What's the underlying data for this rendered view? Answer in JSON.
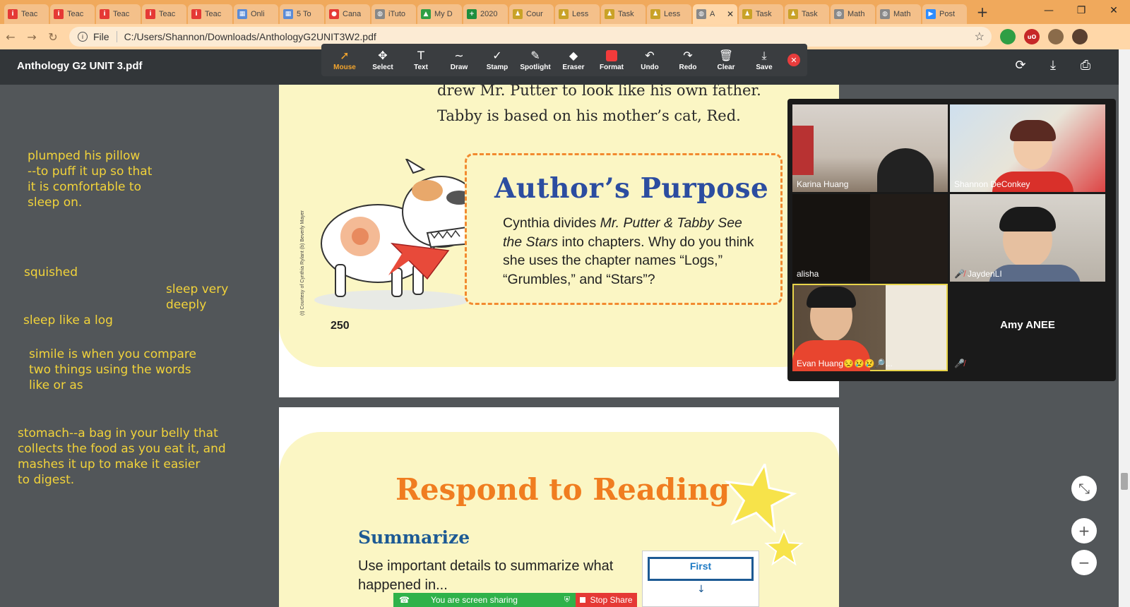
{
  "browser": {
    "tabs": [
      {
        "label": "Teac",
        "icon": "i-ready-icon",
        "color": "#e53935",
        "glyph": "i"
      },
      {
        "label": "Teac",
        "icon": "i-ready-icon",
        "color": "#e53935",
        "glyph": "i"
      },
      {
        "label": "Teac",
        "icon": "i-ready-icon",
        "color": "#e53935",
        "glyph": "i"
      },
      {
        "label": "Teac",
        "icon": "i-ready-icon",
        "color": "#e53935",
        "glyph": "i"
      },
      {
        "label": "Teac",
        "icon": "i-ready-icon",
        "color": "#e53935",
        "glyph": "i"
      },
      {
        "label": "Onli",
        "icon": "doc-icon",
        "color": "#5b8bd6",
        "glyph": "▦"
      },
      {
        "label": "5 To",
        "icon": "doc-icon",
        "color": "#5b8bd6",
        "glyph": "▦"
      },
      {
        "label": "Cana",
        "icon": "canvas-icon",
        "color": "#e53935",
        "glyph": "●"
      },
      {
        "label": "iTuto",
        "icon": "globe-icon",
        "color": "#888888",
        "glyph": "◍"
      },
      {
        "label": "My D",
        "icon": "drive-icon",
        "color": "#2f9e44",
        "glyph": "▲"
      },
      {
        "label": "2020",
        "icon": "sheets-icon",
        "color": "#1e8e3e",
        "glyph": "+"
      },
      {
        "label": "Cour",
        "icon": "person-icon",
        "color": "#c9a227",
        "glyph": "♟"
      },
      {
        "label": "Less",
        "icon": "person-icon",
        "color": "#c9a227",
        "glyph": "♟"
      },
      {
        "label": "Task",
        "icon": "person-icon",
        "color": "#c9a227",
        "glyph": "♟"
      },
      {
        "label": "Less",
        "icon": "person-icon",
        "color": "#c9a227",
        "glyph": "♟"
      },
      {
        "label": "A",
        "icon": "globe-icon",
        "color": "#888888",
        "glyph": "◍",
        "active": true
      },
      {
        "label": "Task",
        "icon": "person-icon",
        "color": "#c9a227",
        "glyph": "♟"
      },
      {
        "label": "Task",
        "icon": "person-icon",
        "color": "#c9a227",
        "glyph": "♟"
      },
      {
        "label": "Math",
        "icon": "globe-icon",
        "color": "#888888",
        "glyph": "◍"
      },
      {
        "label": "Math",
        "icon": "globe-icon",
        "color": "#888888",
        "glyph": "◍"
      },
      {
        "label": "Post",
        "icon": "zoom-icon",
        "color": "#2d8cff",
        "glyph": "▶"
      }
    ],
    "omnibox_scheme": "File",
    "url": "C:/Users/Shannon/Downloads/AnthologyG2UNIT3W2.pdf"
  },
  "pdf": {
    "title": "Anthology G2 UNIT 3.pdf",
    "tools": [
      {
        "label": "Mouse",
        "icon": "cursor-icon",
        "glyph": "➚",
        "active": true
      },
      {
        "label": "Select",
        "icon": "move-icon",
        "glyph": "✥"
      },
      {
        "label": "Text",
        "icon": "text-icon",
        "glyph": "T"
      },
      {
        "label": "Draw",
        "icon": "draw-icon",
        "glyph": "∼"
      },
      {
        "label": "Stamp",
        "icon": "stamp-icon",
        "glyph": "✓"
      },
      {
        "label": "Spotlight",
        "icon": "spotlight-icon",
        "glyph": "✎"
      },
      {
        "label": "Eraser",
        "icon": "eraser-icon",
        "glyph": "◆"
      },
      {
        "label": "Format",
        "icon": "format-icon",
        "glyph": ""
      },
      {
        "label": "Undo",
        "icon": "undo-icon",
        "glyph": "↶"
      },
      {
        "label": "Redo",
        "icon": "redo-icon",
        "glyph": "↷"
      },
      {
        "label": "Clear",
        "icon": "trash-icon",
        "glyph": "🗑"
      },
      {
        "label": "Save",
        "icon": "save-icon",
        "glyph": "⤓"
      }
    ],
    "page1": {
      "line1": "drew Mr. Putter to look like his own father.",
      "line2": "Tabby is based on his mother’s cat, Red.",
      "box_title": "Author’s Purpose",
      "box_text_1": "Cynthia divides ",
      "box_text_italic": "Mr. Putter & Tabby See the Stars",
      "box_text_2": " into chapters. Why do you think she uses the chapter names “Logs,” “Grumbles,” and “Stars”?",
      "credit": "(t) Courtesy of Cynthia Rylant (b) Beverly Mayer",
      "page_number": "250"
    },
    "page2": {
      "title": "Respond to Reading",
      "subhead": "Summarize",
      "text": "Use important details to summarize what happened in...",
      "box_label": "First"
    }
  },
  "notes": [
    "plumped his pillow\n--to puff it up so that\nit is comfortable to\nsleep on.",
    "squished",
    "sleep very\ndeeply",
    "sleep like a log",
    "simile is when you compare\ntwo things using the words\nlike or as",
    "stomach--a bag in your belly that\ncollects the food as you eat it, and\nmashes it up to make it easier\nto digest."
  ],
  "zoom": {
    "participants": [
      {
        "name": "Karina Huang",
        "muted": false
      },
      {
        "name": "Shannon DeConkey",
        "muted": false
      },
      {
        "name": "alisha",
        "muted": false
      },
      {
        "name": "JaydenLI",
        "muted": true
      },
      {
        "name": "Evan Huang😒😢😢🔎...",
        "muted": false,
        "speaking": true
      },
      {
        "name": "Amy ANEE",
        "muted": true,
        "video_off": true
      }
    ]
  },
  "sharing": {
    "message": "You are screen sharing",
    "stop_label": "Stop Share"
  }
}
